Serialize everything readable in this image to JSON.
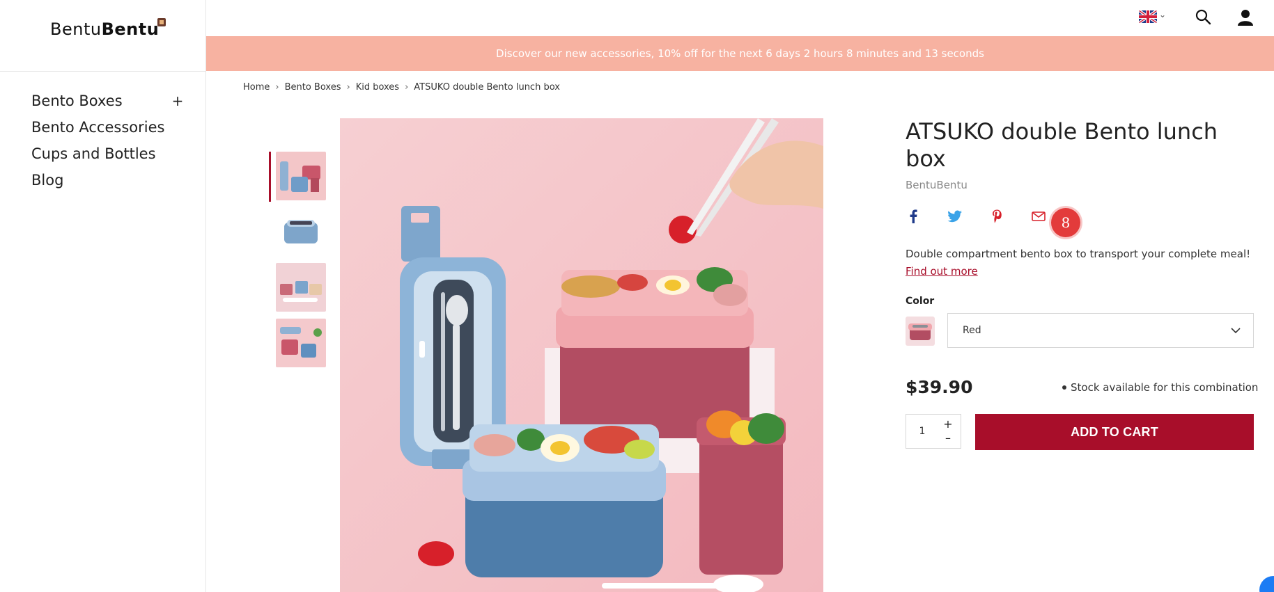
{
  "brand_logo": {
    "light": "Bentu",
    "bold": "Bentu"
  },
  "sidebar": {
    "items": [
      {
        "label": "Bento Boxes",
        "expand": "+"
      },
      {
        "label": "Bento Accessories"
      },
      {
        "label": "Cups and Bottles"
      },
      {
        "label": "Blog"
      }
    ]
  },
  "header": {
    "language_icon": "uk-flag-icon",
    "icons": [
      "search-icon",
      "user-icon"
    ]
  },
  "banner": {
    "text": "Discover our new accessories, 10% off for the next ",
    "countdown": "6 days 2 hours 8 minutes and 13 seconds"
  },
  "breadcrumb": [
    "Home",
    "Bento Boxes",
    "Kid boxes",
    "ATSUKO double Bento lunch box"
  ],
  "product": {
    "title": "ATSUKO double Bento lunch box",
    "brand": "BentuBentu",
    "share_count": "8",
    "description": "Double compartment bento box to transport your complete meal!",
    "find_more": "Find out more",
    "color_label": "Color",
    "color_value": "Red",
    "price": "$39.90",
    "stock": "Stock available for this combination",
    "quantity": "1",
    "add_to_cart": "ADD TO CART"
  },
  "colors": {
    "accent": "#a80e2a",
    "banner": "#f7b2a1",
    "image_bg": "#f5c9cc"
  }
}
